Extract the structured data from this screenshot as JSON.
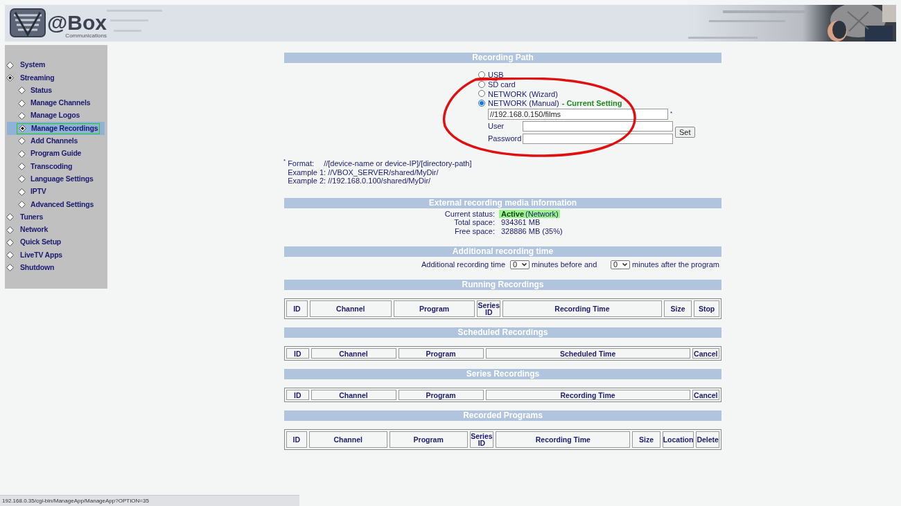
{
  "header": {
    "logo_text": "@Box",
    "logo_subtext": "Communications"
  },
  "sidebar": {
    "items": [
      {
        "label": "System",
        "expanded": false
      },
      {
        "label": "Streaming",
        "expanded": true,
        "children": [
          {
            "label": "Status",
            "selected": false
          },
          {
            "label": "Manage Channels",
            "selected": false
          },
          {
            "label": "Manage Logos",
            "selected": false
          },
          {
            "label": "Manage Recordings",
            "selected": true
          },
          {
            "label": "Add Channels",
            "selected": false
          },
          {
            "label": "Program Guide",
            "selected": false
          },
          {
            "label": "Transcoding",
            "selected": false
          },
          {
            "label": "Language Settings",
            "selected": false
          },
          {
            "label": "IPTV",
            "selected": false
          },
          {
            "label": "Advanced Settings",
            "selected": false
          }
        ]
      },
      {
        "label": "Tuners",
        "expanded": false
      },
      {
        "label": "Network",
        "expanded": false
      },
      {
        "label": "Quick Setup",
        "expanded": false
      },
      {
        "label": "LiveTV Apps",
        "expanded": false
      },
      {
        "label": "Shutdown",
        "expanded": false
      }
    ]
  },
  "recording_path": {
    "title": "Recording Path",
    "options": [
      {
        "label": "USB",
        "selected": false
      },
      {
        "label": "SD card",
        "selected": false
      },
      {
        "label": "NETWORK (Wizard)",
        "selected": false
      },
      {
        "label": "NETWORK (Manual)",
        "selected": true,
        "note": "- Current Setting"
      }
    ],
    "path_value": "//192.168.0.150/films",
    "required_mark": "*",
    "user_label": "User",
    "password_label": "Password",
    "set_button": "Set",
    "format_mark": "*",
    "format_lines": [
      {
        "label": "Format:",
        "value": "//[device-name or device-IP]/[directory-path]"
      },
      {
        "label": "Example 1:",
        "value": "//VBOX_SERVER/shared/MyDir/"
      },
      {
        "label": "Example 2:",
        "value": "//192.168.0.100/shared/MyDir/"
      }
    ]
  },
  "media_info": {
    "title": "External recording media information",
    "status_label": "Current status:",
    "status": "Active",
    "status_detail": "(Network)",
    "rows": [
      {
        "label": "Total space:",
        "value": "934361 MB"
      },
      {
        "label": "Free space:",
        "value": "328886 MB (35%)"
      }
    ]
  },
  "additional_time": {
    "title": "Additional recording time",
    "label": "Additional recording time",
    "before_value": "0",
    "before_text": "minutes before and",
    "after_value": "0",
    "after_text": "minutes after the program"
  },
  "tables": [
    {
      "title": "Running Recordings",
      "columns": [
        "ID",
        "Channel",
        "Program",
        "Series ID",
        "Recording Time",
        "Size",
        "Stop"
      ]
    },
    {
      "title": "Scheduled Recordings",
      "columns": [
        "ID",
        "Channel",
        "Program",
        "Scheduled Time",
        "Cancel"
      ]
    },
    {
      "title": "Series Recordings",
      "columns": [
        "ID",
        "Channel",
        "Program",
        "Recording Time",
        "Cancel"
      ]
    },
    {
      "title": "Recorded Programs",
      "columns": [
        "ID",
        "Channel",
        "Program",
        "Series ID",
        "Recording Time",
        "Size",
        "Location",
        "Delete"
      ]
    }
  ],
  "status_bar": {
    "url": "192.168.0.35/cgi-bin/ManageApp/ManageApp?OPTION=35"
  }
}
